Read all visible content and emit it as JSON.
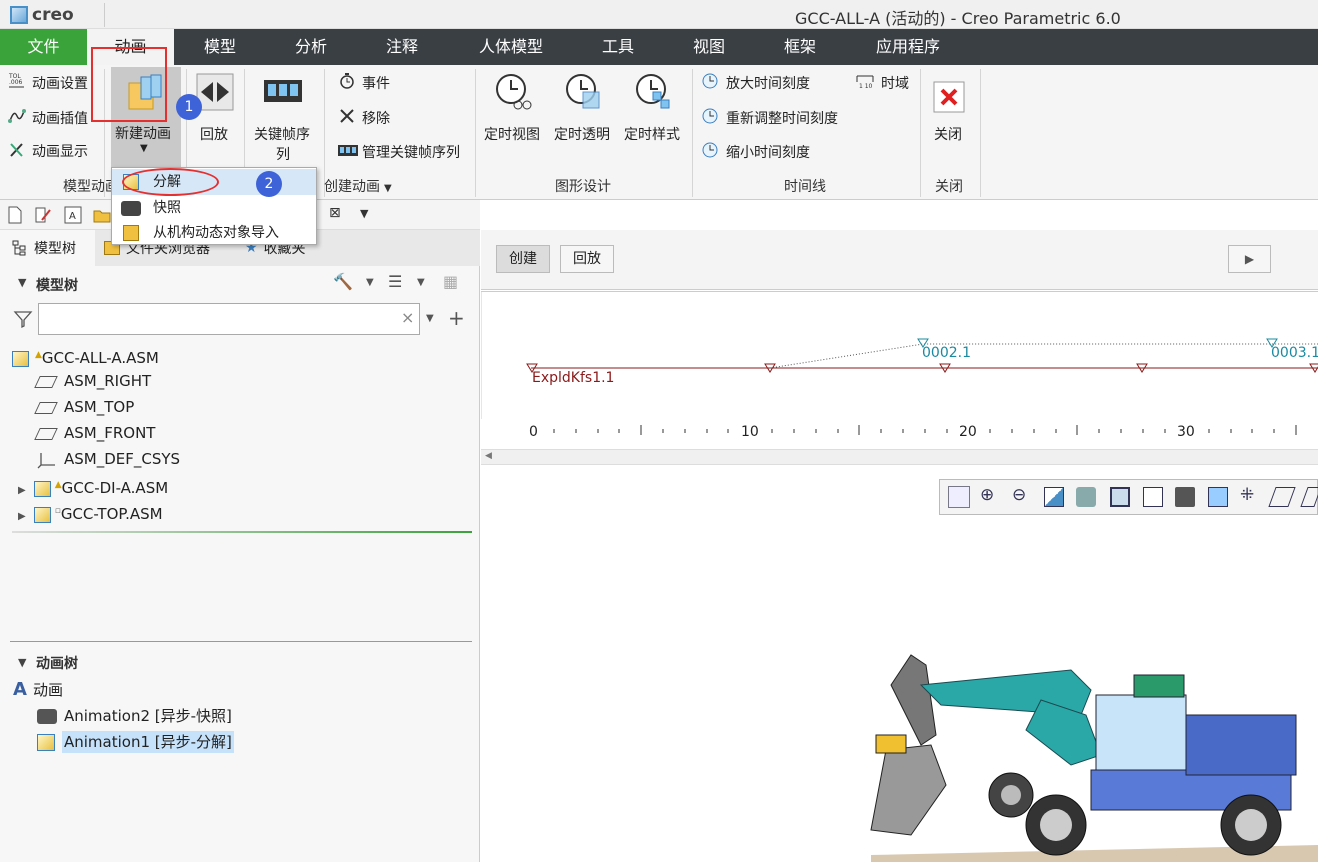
{
  "app": {
    "logo_text": "creo",
    "window_title": "GCC-ALL-A (活动的) - Creo Parametric 6.0"
  },
  "menu": {
    "items": [
      "文件",
      "动画",
      "模型",
      "分析",
      "注释",
      "人体模型",
      "工具",
      "视图",
      "框架",
      "应用程序"
    ],
    "active": "动画"
  },
  "ribbon": {
    "model_anim_group": {
      "label": "模型动画",
      "items": [
        "动画设置",
        "动画插值",
        "动画显示"
      ]
    },
    "new_anim": {
      "label": "新建动画"
    },
    "playback": {
      "label": "回放"
    },
    "keyframe": {
      "label_line1": "关键帧序",
      "label_line2": "列"
    },
    "create_anim_group": {
      "label": "创建动画",
      "items": [
        "事件",
        "移除",
        "管理关键帧序列"
      ]
    },
    "graphic_design_group": {
      "label": "图形设计",
      "items": [
        "定时视图",
        "定时透明",
        "定时样式"
      ]
    },
    "timeline_group": {
      "label": "时间线",
      "items": [
        "放大时间刻度",
        "重新调整时间刻度",
        "缩小时间刻度",
        "时域"
      ]
    },
    "close_group": {
      "label": "关闭",
      "button": "关闭"
    }
  },
  "dropdown": {
    "items": [
      "分解",
      "快照",
      "从机构动态对象导入"
    ]
  },
  "panel_tabs": {
    "model_tree": "模型树",
    "file_browser": "文件夹浏览器",
    "favorites": "收藏夹"
  },
  "model_tree": {
    "header": "模型树",
    "search_value": "",
    "items": [
      {
        "name": "GCC-ALL-A.ASM",
        "mark": "▲"
      },
      {
        "name": "ASM_RIGHT"
      },
      {
        "name": "ASM_TOP"
      },
      {
        "name": "ASM_FRONT"
      },
      {
        "name": "ASM_DEF_CSYS"
      },
      {
        "name": "GCC-DI-A.ASM",
        "mark": "▲"
      },
      {
        "name": "GCC-TOP.ASM",
        "mark": "▫"
      }
    ]
  },
  "anim_tree": {
    "header": "动画树",
    "root": "动画",
    "items": [
      "Animation2 [异步-快照]",
      "Animation1 [异步-分解]"
    ]
  },
  "anim_toolbar": {
    "create": "创建",
    "playback": "回放"
  },
  "timeline": {
    "track_label": "ExpldKfs1.1",
    "key_labels": [
      "0002.1",
      "0003.1"
    ],
    "ruler_labels": [
      "0",
      "10",
      "20",
      "30"
    ]
  },
  "annotations": {
    "badge1": "1",
    "badge2": "2"
  },
  "colors": {
    "menu_bg": "#3a3f44",
    "file_tab": "#3aa33a",
    "annotation_red": "#e53030",
    "badge_blue": "#3e63d8",
    "timeline_track": "#8b1a1a",
    "key_cyan": "#1a8aa0"
  }
}
